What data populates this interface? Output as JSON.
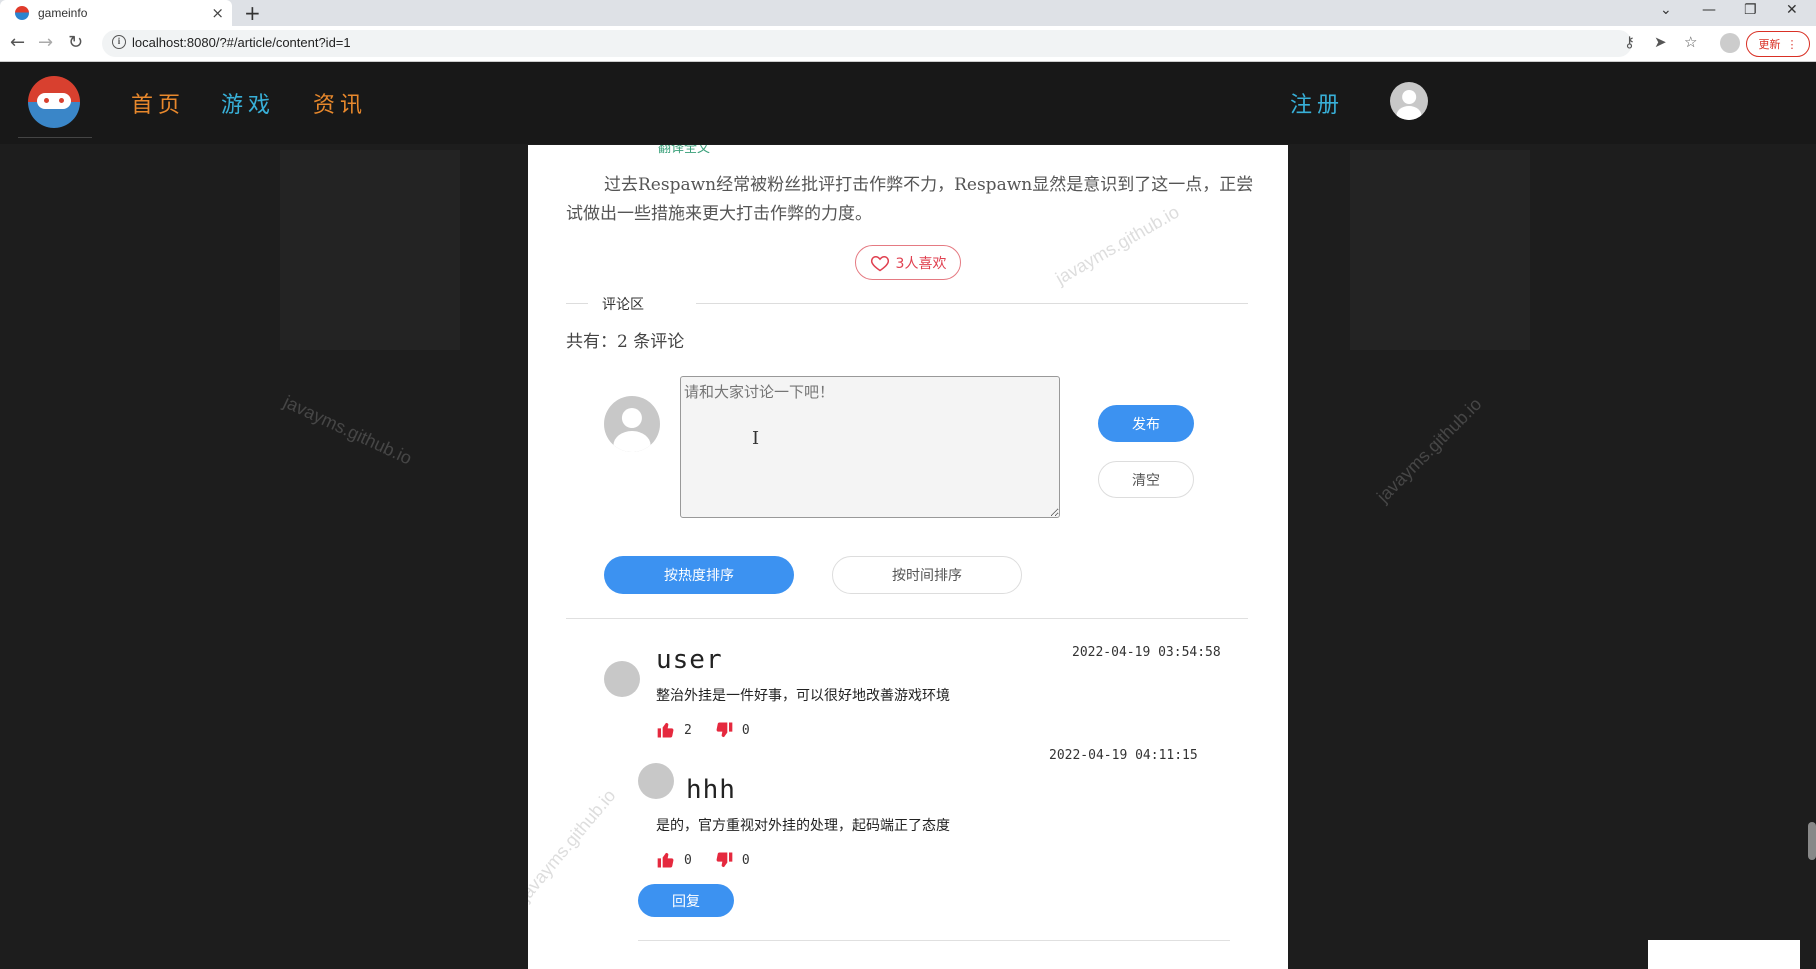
{
  "browser": {
    "tab_title": "gameinfo",
    "tab_close": "×",
    "new_tab": "+",
    "url": "localhost:8080/?#/article/content?id=1",
    "update_label": "更新",
    "window_controls": [
      "⌄",
      "—",
      "❐",
      "✕"
    ]
  },
  "header": {
    "nav": {
      "home": "首页",
      "games": "游戏",
      "news": "资讯",
      "register": "注册"
    }
  },
  "article": {
    "clipped_text": "翻译全文",
    "paragraph": "过去Respawn经常被粉丝批评打击作弊不力，Respawn显然是意识到了这一点，正尝试做出一些措施来更大打击作弊的力度。",
    "likes_label": "3人喜欢"
  },
  "comments": {
    "section_label": "评论区",
    "count_text": "共有：2 条评论",
    "placeholder": "请和大家讨论一下吧！",
    "publish_label": "发布",
    "clear_label": "清空",
    "sort_hot_label": "按热度排序",
    "sort_time_label": "按时间排序",
    "items": [
      {
        "user": "user",
        "time": "2022-04-19 03:54:58",
        "text": "整治外挂是一件好事，可以很好地改善游戏环境",
        "likes": "2",
        "dislikes": "0"
      }
    ],
    "replies": [
      {
        "user": "hhh",
        "time": "2022-04-19 04:11:15",
        "text": "是的，官方重视对外挂的处理，起码端正了态度",
        "likes": "0",
        "dislikes": "0"
      }
    ],
    "reply_label": "回复"
  },
  "watermark": "javayms.github.io",
  "colors": {
    "accent_blue": "#3c92f1",
    "nav_orange": "#e8882c",
    "nav_cyan": "#38b0d8",
    "like_red": "#e04050"
  }
}
